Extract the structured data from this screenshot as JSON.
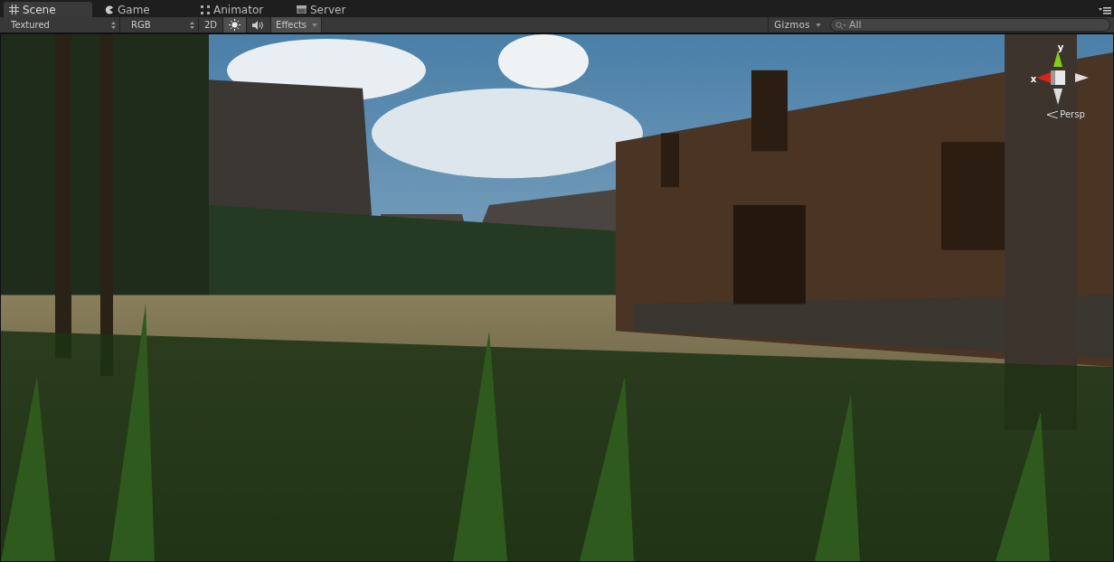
{
  "tabs": [
    {
      "label": "Scene",
      "selected": true
    },
    {
      "label": "Game",
      "selected": false
    },
    {
      "label": "Animator",
      "selected": false
    },
    {
      "label": "Server",
      "selected": false
    }
  ],
  "toolbar": {
    "draw_mode": "Textured",
    "render_mode": "RGB",
    "toggles": [
      {
        "kind": "text",
        "label": "2D",
        "on": false
      },
      {
        "kind": "sun",
        "on": true
      },
      {
        "kind": "speaker",
        "on": false
      }
    ],
    "effects": {
      "label": "Effects",
      "on": true
    },
    "gizmos": "Gizmos",
    "search": {
      "placeholder": "All"
    }
  },
  "gizmo": {
    "y_label": "y",
    "x_label": "x",
    "projection": "Persp"
  }
}
